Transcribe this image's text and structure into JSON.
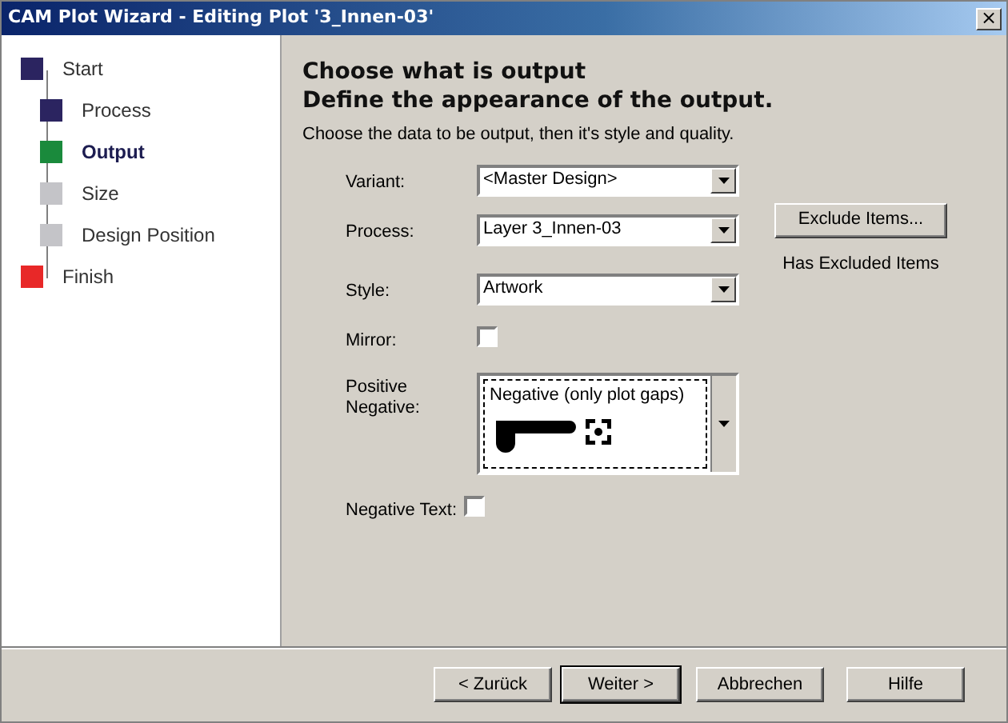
{
  "window": {
    "title": "CAM Plot Wizard - Editing Plot '3_Innen-03'",
    "close": "×"
  },
  "steps": [
    {
      "label": "Start",
      "color": "#2b2460",
      "selected": false,
      "children": [
        {
          "label": "Process",
          "color": "#2b2460",
          "selected": false
        },
        {
          "label": "Output",
          "color": "#1a8a3c",
          "selected": true
        },
        {
          "label": "Size",
          "color": "#c4c4c8",
          "selected": false
        },
        {
          "label": "Design Position",
          "color": "#c4c4c8",
          "selected": false
        }
      ]
    },
    {
      "label": "Finish",
      "color": "#e82828",
      "selected": false
    }
  ],
  "heading": [
    "Choose what is output",
    "Define the appearance of the output."
  ],
  "intro": "Choose the data to be output, then it's style and quality.",
  "fields": [
    {
      "kind": "select",
      "label": "Variant:",
      "value": "<Master Design>"
    },
    {
      "kind": "select",
      "label": "Process:",
      "value": "Layer 3_Innen-03"
    },
    {
      "kind": "select",
      "label": "Style:",
      "value": "Artwork"
    },
    {
      "kind": "checkbox",
      "label": "Mirror:",
      "checked": false
    },
    {
      "kind": "preview",
      "label": "Positive Negative:",
      "value": "Negative (only plot gaps)"
    },
    {
      "kind": "checkbox",
      "label": "Negative Text:",
      "checked": false
    }
  ],
  "exclude": {
    "button": "Exclude Items...",
    "note": "Has Excluded Items"
  },
  "buttons": [
    {
      "label": "< Zurück",
      "default": false
    },
    {
      "label": "Weiter >",
      "default": true
    },
    {
      "label": "Abbrechen",
      "default": false
    },
    {
      "label": "Hilfe",
      "default": false
    }
  ]
}
